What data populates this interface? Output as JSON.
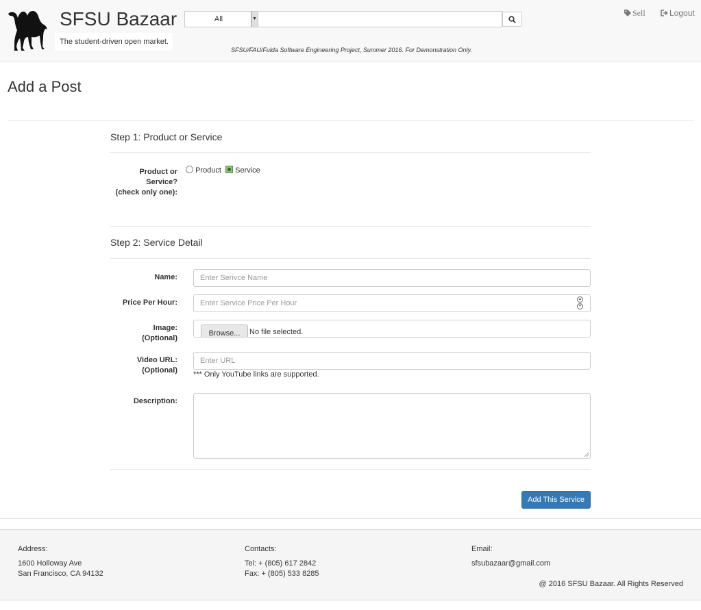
{
  "header": {
    "site_title": "SFSU Bazaar",
    "tagline": "The student-driven open market.",
    "search": {
      "category_selected": "All",
      "placeholder": ""
    },
    "disclaimer": "SFSU/FAU/Fulda Software Engineering Project, Summer 2016. For Demonstration Only.",
    "nav": {
      "sell_label": "Sell",
      "logout_label": "Logout"
    }
  },
  "page_title": "Add a Post",
  "step1": {
    "title": "Step 1: Product or Service",
    "question_lines": [
      "Product or",
      "Service?",
      "(check only one):"
    ],
    "options": [
      {
        "label": "Product",
        "checked": false
      },
      {
        "label": "Service",
        "checked": true
      }
    ]
  },
  "step2": {
    "title": "Step 2: Service Detail",
    "name_label": "Name:",
    "name_placeholder": "Enter Serivce Name",
    "price_label": "Price Per Hour:",
    "price_placeholder": "Enter Service Price Per Hour",
    "image_label_lines": [
      "Image:",
      "(Optional)"
    ],
    "browse_label": "Browse...",
    "file_status": "No file selected.",
    "video_label_lines": [
      "Video URL:",
      "(Optional)"
    ],
    "video_placeholder": "Enter URL",
    "video_help": "*** Only YouTube links are supported.",
    "description_label": "Description:",
    "submit_label": "Add This Service"
  },
  "footer": {
    "address_title": "Address:",
    "address_lines": [
      "1600 Holloway Ave",
      "San Francisco, CA 94132"
    ],
    "contacts_title": "Contacts:",
    "contacts_lines": [
      "Tel: + (805) 617 2842",
      "Fax: + (805) 533 8285"
    ],
    "email_title": "Email:",
    "email": "sfsubazaar@gmail.com",
    "copyright": "@ 2016 SFSU Bazaar. All Rights Reserved"
  },
  "colors": {
    "primary_button": "#337ab7",
    "header_bg": "#f8f8f8",
    "footer_bg": "#f5f5f5"
  },
  "icons": {
    "logo": "camel-logo",
    "search": "search-icon",
    "sell": "tag-icon",
    "logout": "logout-icon"
  }
}
